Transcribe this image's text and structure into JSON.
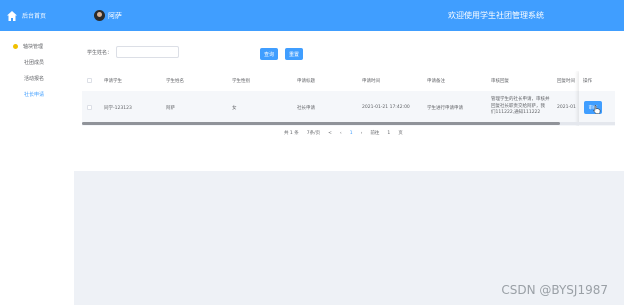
{
  "sidebar": {
    "home_label": "后台首页",
    "group_label": "轴块管理",
    "items": [
      {
        "label": "社团成员"
      },
      {
        "label": "活动报名"
      },
      {
        "label": "社长申请"
      }
    ],
    "accent_color": "#409eff"
  },
  "header": {
    "user_name": "阿萨",
    "system_title": "欢迎使用学生社团管理系统"
  },
  "search": {
    "label": "学生姓名：",
    "input_value": "",
    "search_button": "查询",
    "reset_button": "重置"
  },
  "table": {
    "headers": [
      "申请学生",
      "学生姓名",
      "学生性别",
      "申请标题",
      "申请时间",
      "申请备注",
      "审核回复",
      "回复时间",
      "操作"
    ],
    "rows": [
      {
        "student_account": "同学-123123",
        "student_name": "阿萨",
        "gender": "女",
        "title": "社长申请",
        "apply_time": "2021-01-21 17:42:00",
        "remark": "学生进行申请申请",
        "reply_line1": "管理学生的社长申请，审核并",
        "reply_line2": "回复社长职责交给阿萨，我",
        "reply_line3": "们111222,通知111222",
        "reply_time": "2021-01",
        "action": "审核"
      }
    ]
  },
  "pagination": {
    "total": "共 1 条",
    "page_size": "7条/页",
    "prev": "<",
    "ellipsis": "‹",
    "current": "1",
    "next": "›",
    "goto": "前往",
    "goto_page": "1",
    "page_unit": "页"
  },
  "watermark": "CSDN @BYSJ1987"
}
